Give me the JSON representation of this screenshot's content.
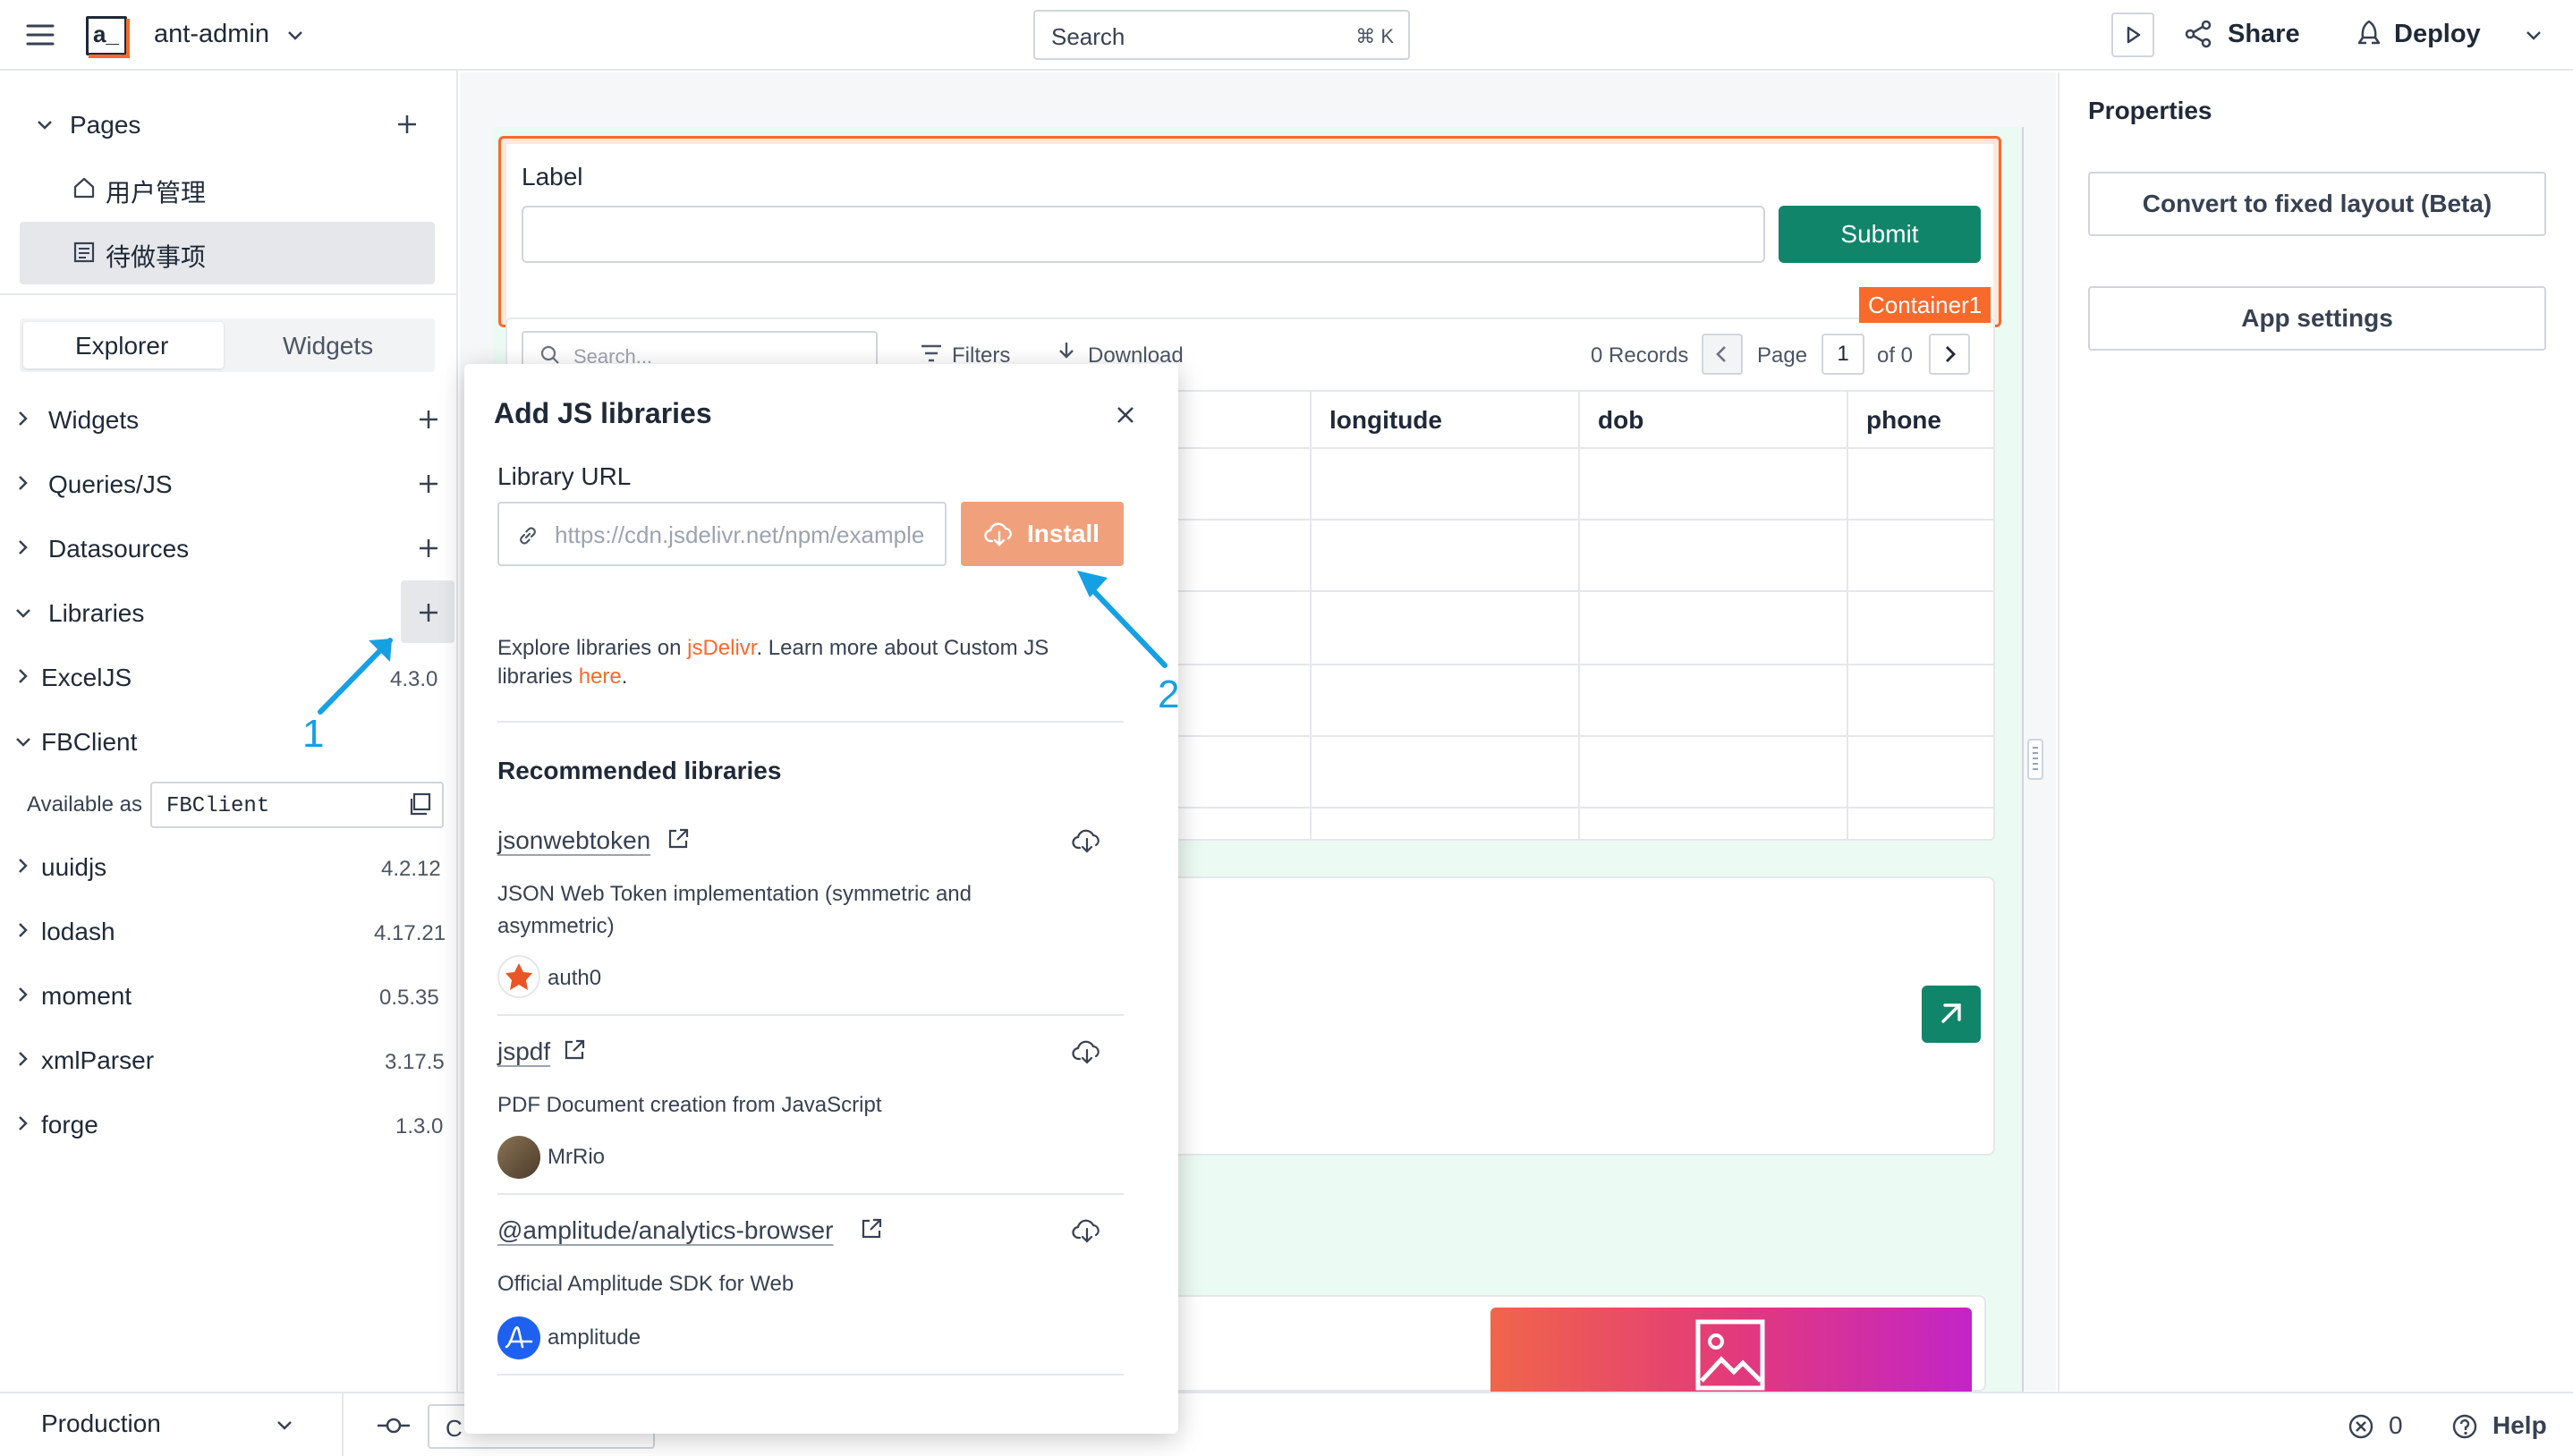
{
  "header": {
    "app_name": "ant-admin",
    "search_placeholder": "Search",
    "search_shortcut": "⌘ K",
    "share_label": "Share",
    "deploy_label": "Deploy"
  },
  "sidebar": {
    "pages_label": "Pages",
    "pages": [
      {
        "label": "用户管理",
        "icon": "home-icon",
        "active": false
      },
      {
        "label": "待做事项",
        "icon": "page-icon",
        "active": true
      }
    ],
    "tabs": [
      "Explorer",
      "Widgets"
    ],
    "active_tab": "Explorer",
    "sections": [
      {
        "label": "Widgets"
      },
      {
        "label": "Queries/JS"
      },
      {
        "label": "Datasources"
      },
      {
        "label": "Libraries"
      }
    ],
    "libraries": [
      {
        "name": "ExcelJS",
        "version": "4.3.0"
      },
      {
        "name": "FBClient",
        "version": "",
        "available_as_label": "Available as",
        "available_as": "FBClient"
      },
      {
        "name": "uuidjs",
        "version": "4.2.12"
      },
      {
        "name": "lodash",
        "version": "4.17.21"
      },
      {
        "name": "moment",
        "version": "0.5.35"
      },
      {
        "name": "xmlParser",
        "version": "3.17.5"
      },
      {
        "name": "forge",
        "version": "1.3.0"
      }
    ]
  },
  "bottom_bar": {
    "environment": "Production",
    "commit_input": "C",
    "error_count": "0",
    "help_label": "Help"
  },
  "canvas": {
    "container": {
      "label": "Label",
      "submit_label": "Submit",
      "tag": "Container1"
    },
    "table": {
      "search_placeholder": "Search...",
      "filters_label": "Filters",
      "download_label": "Download",
      "records": "0 Records",
      "page_label": "Page",
      "page_number": "1",
      "page_total": "of 0",
      "columns": [
        "longitude",
        "dob",
        "phone"
      ]
    }
  },
  "properties": {
    "title": "Properties",
    "convert_button": "Convert to fixed layout (Beta)",
    "settings_button": "App settings"
  },
  "modal": {
    "title": "Add JS libraries",
    "url_label": "Library URL",
    "url_placeholder": "https://cdn.jsdelivr.net/npm/example",
    "install_label": "Install",
    "note_prefix": "Explore libraries on ",
    "note_link1": "jsDelivr",
    "note_middle": ". Learn more about Custom JS libraries ",
    "note_link2": "here",
    "note_suffix": ".",
    "recommended_title": "Recommended libraries",
    "libraries": [
      {
        "name": "jsonwebtoken",
        "description": "JSON Web Token implementation (symmetric and asymmetric)",
        "author": "auth0"
      },
      {
        "name": "jspdf",
        "description": "PDF Document creation from JavaScript",
        "author": "MrRio"
      },
      {
        "name": "@amplitude/analytics-browser",
        "description": "Official Amplitude SDK for Web",
        "author": "amplitude"
      }
    ]
  },
  "annotations": [
    "1",
    "2"
  ],
  "colors": {
    "brand": "#f86a2b",
    "primary_green": "#11856a",
    "install_button": "#f0a17b",
    "annotation": "#16a0e4",
    "canvas_bg": "#ecfaf4"
  }
}
